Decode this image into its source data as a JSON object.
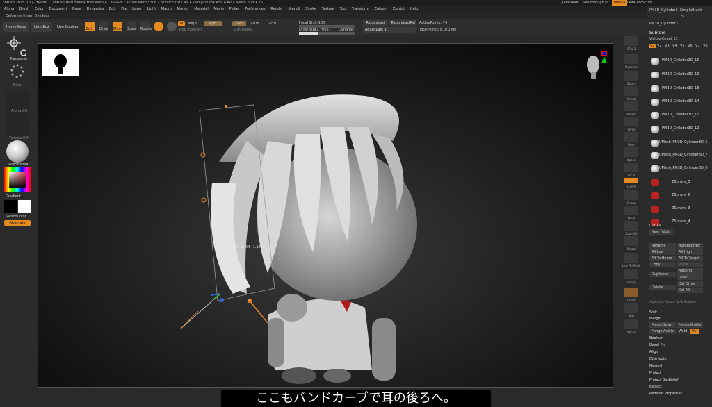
{
  "titlebar": {
    "app_title": "ZBrush 2025.0.1 [23中 No.]",
    "document": "ZBrush Document",
    "status": "• Free Mem 47.355GB • Active Mem 5306 • Scratch Disk 45 • • PolyCount• 458.4 KP • MeshCount• 15",
    "quicksave": "QuickSave",
    "seethrough": "See-through 0",
    "menus_btn": "Menus",
    "default_script": "DefaultZScript"
  },
  "menubar": {
    "items": [
      "Alpha",
      "Brush",
      "Color",
      "Document",
      "Draw",
      "Dynamics",
      "Edit",
      "File",
      "Layer",
      "Light",
      "Macro",
      "Marker",
      "Material",
      "Movie",
      "Picker",
      "Preferences",
      "Render",
      "Stencil",
      "Stroke",
      "Texture",
      "Tool",
      "Transform",
      "Zplugin",
      "Zscript",
      "Help"
    ]
  },
  "deformer": {
    "label": "Deformer timer: 0 mSecs"
  },
  "toolbar": {
    "home_page": "Home Page",
    "lightbox": "LightBox",
    "live_boolean": "Live Boolean",
    "edit": "Edit",
    "draw": "Draw",
    "move": "Move",
    "scale": "Scale",
    "rotate": "Rotate",
    "mrgb": "Mrgb",
    "rgb": "Rgb",
    "m": "M",
    "zadd": "Zadd",
    "zsub": "Zsub",
    "zcut": "Zcut",
    "rgb_intensity": "Rgb Intensity",
    "z_intensity": "Z Intensity",
    "focal_shift_label": "Focal Shift",
    "focal_shift_value": "-100",
    "draw_size_label": "Draw Size",
    "draw_size_value": "32.70057",
    "dynamic": "Dynamic",
    "replay_last": "ReplayLast",
    "replay_last_rel": "ReplayLastRel",
    "adjust_last": "AdjustLast 1",
    "active_points": "ActivePoints: 74",
    "total_points": "TotalPoints: 8.070 Mil",
    "focal_shift_fill": 0.0,
    "draw_size_fill": 0.35
  },
  "leftpanel": {
    "transpose": "Transpose",
    "blob": "Blob",
    "alpha_off": "Alpha Off",
    "texture_off": "Texture Off",
    "matcap": "SkinShade4",
    "gradient": "Gradient",
    "switch_color": "SwitchColor",
    "alternate": "Alternate"
  },
  "dock": {
    "labels": [
      "SPix 3",
      "Dynamic",
      "Zoom",
      "Actual",
      "AAHalf",
      "Persp",
      "Floor",
      "Xpose",
      "Local",
      "L.Sym",
      "Frame",
      "Move",
      "Zoom3D",
      "Rotate",
      "Line Fill PolyF",
      "Transp",
      "Ghost",
      "Solo",
      "Xpose"
    ]
  },
  "subtool_panel": {
    "top_items": [
      "PM3D_Cylinder3",
      "SimpleBrush",
      "25",
      "PM3D_Cylinder3"
    ],
    "header": "Subtool",
    "visible_count": "Visible Count 13",
    "versions": [
      "V1",
      "V2",
      "V3",
      "V4",
      "V5",
      "V6",
      "V7",
      "V8"
    ],
    "rows": [
      "PM3D_Cylinder3D_15",
      "PM3D_Cylinder3D_13",
      "PM3D_Cylinder3D_18",
      "PM3D_Cylinder3D_14",
      "PM3D_Cylinder3D_11",
      "PM3D_Cylinder3D_12",
      "UMesh_PM3D_Cylinder3D_5",
      "UMesh_PM3D_Cylinder3D_7",
      "UMesh_PM3D_Cylinder3D_6",
      "ZSphere_5",
      "ZSphere_6",
      "ZSphere_3",
      "ZSphere_4"
    ],
    "list_all": "List All",
    "new_folder": "New Folder",
    "rename": "Rename",
    "auto_reorder": "AutoReorder",
    "all_low": "All Low",
    "all_high": "All High",
    "all_to_home": "All To Home",
    "all_to_target": "All To Target",
    "copy": "Copy",
    "paste": "Paste",
    "duplicate": "Duplicate",
    "append": "Append",
    "insert": "Insert",
    "delete": "Delete",
    "del_other": "Del Other",
    "del_all": "Del All",
    "apply_link": "Apply Link Actions To All Subtools",
    "split": "Split",
    "merge": "Merge",
    "merge_down": "MergeDown",
    "merge_similar": "MergeSimilar",
    "merge_visible": "MergeVisible",
    "weld": "Weld",
    "uv": "Uv",
    "menu": [
      "Boolean",
      "Bevel Pro",
      "Align",
      "Distribute",
      "Remesh",
      "Project",
      "Project BasRelief",
      "Extract",
      "Redshift Properties"
    ]
  },
  "viewport": {
    "gizmo_readout": "0.0255 0.105 -1.1415"
  },
  "subtitle": {
    "text": "ここもバンドカーブで耳の後ろへ。"
  },
  "colors": {
    "accent": "#e58a1f",
    "panel": "#2b2b2b",
    "canvas": "#1d1d1d"
  }
}
